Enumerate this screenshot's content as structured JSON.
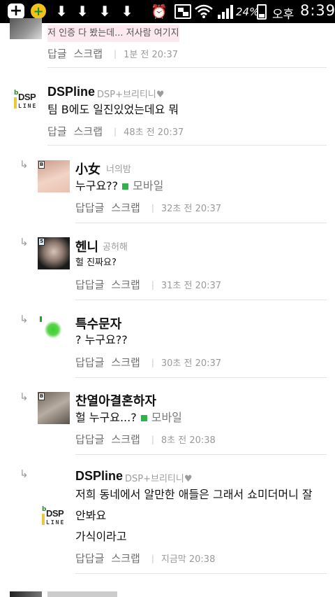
{
  "status_bar": {
    "plus_icon": "+",
    "coin_icon": "+",
    "download_icon": "⬇",
    "alarm_icon": "⏰",
    "battery_percent": "24%",
    "ampm": "오후",
    "time": "8:39"
  },
  "comments": [
    {
      "id": "c0",
      "text": "저 인증 다 봤는데... 저사람 여기지",
      "reply_label": "답글",
      "scrap_label": "스크랩",
      "time": "1분 전 20:37"
    },
    {
      "id": "c1",
      "nickname": "DSPline",
      "subnick": "DSP+브리티니♥",
      "text": "팀 B에도 일진있었는데요 뭐",
      "reply_label": "답글",
      "scrap_label": "스크랩",
      "time": "48초 전 20:37"
    }
  ],
  "replies": [
    {
      "nickname": "小女",
      "subnick": "너의밤",
      "text": "누구요??",
      "mobile": "모바일",
      "reply_label": "답답글",
      "scrap_label": "스크랩",
      "time": "32초 전 20:37"
    },
    {
      "nickname": "헨니",
      "subnick": "공허해",
      "text": "헐 진짜요?",
      "reply_label": "답답글",
      "scrap_label": "스크랩",
      "time": "31초 전 20:37"
    },
    {
      "nickname": "특수문자",
      "text": "? 누구요??",
      "reply_label": "답답글",
      "scrap_label": "스크랩",
      "time": "30초 전 20:37"
    },
    {
      "nickname": "찬열아결혼하자",
      "text": "헐 누구요...?",
      "mobile": "모바일",
      "reply_label": "답답글",
      "scrap_label": "스크랩",
      "time": "8초 전 20:38"
    },
    {
      "nickname": "DSPline",
      "subnick": "DSP+브리티니♥",
      "text_line1": "저희 동네에서 알만한 애들은 그래서 쇼미더머니 잘",
      "text_line2": "안봐요",
      "text_line3": "가식이라고",
      "reply_label": "답답글",
      "scrap_label": "스크랩",
      "time": "지금막 20:38"
    }
  ],
  "avatar_badges": {
    "r0": "B",
    "r1": "5",
    "r3": "B"
  },
  "dsp_logo": {
    "letter_b": "b",
    "word_dsp": "DSP",
    "word_line": "LINE"
  },
  "reply_arrow_icon": "↳",
  "separator": "|"
}
